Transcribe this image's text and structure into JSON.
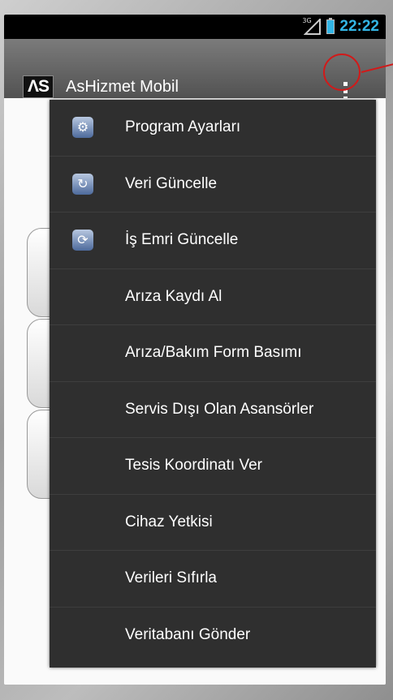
{
  "status": {
    "network": "3G",
    "time": "22:22"
  },
  "app": {
    "logo": "ΛS",
    "title": "AsHizmet Mobil"
  },
  "menu": {
    "items": [
      {
        "label": "Program Ayarları",
        "icon": "gear-icon"
      },
      {
        "label": "Veri Güncelle",
        "icon": "refresh-icon"
      },
      {
        "label": "İş Emri Güncelle",
        "icon": "sync-icon"
      },
      {
        "label": "Arıza Kaydı Al"
      },
      {
        "label": "Arıza/Bakım Form Basımı"
      },
      {
        "label": "Servis Dışı Olan Asansörler"
      },
      {
        "label": "Tesis Koordinatı Ver"
      },
      {
        "label": "Cihaz Yetkisi"
      },
      {
        "label": "Verileri Sıfırla"
      },
      {
        "label": "Veritabanı Gönder"
      }
    ]
  },
  "colors": {
    "accent": "#33b5e5",
    "menu_bg": "#2f2f2f",
    "annotation": "#d11a1a"
  }
}
